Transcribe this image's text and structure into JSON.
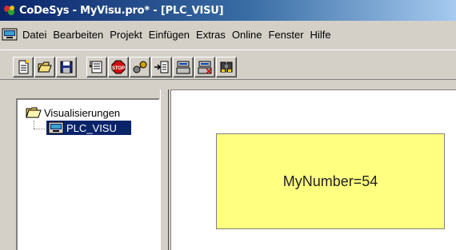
{
  "window": {
    "title": "CoDeSys - MyVisu.pro* - [PLC_VISU]",
    "icon": "codesys-app-icon"
  },
  "menubar": {
    "doc_icon": "visualization-document-icon",
    "items": [
      "Datei",
      "Bearbeiten",
      "Projekt",
      "Einfügen",
      "Extras",
      "Online",
      "Fenster",
      "Hilfe"
    ]
  },
  "toolbar": {
    "buttons": [
      {
        "name": "new-file-icon"
      },
      {
        "name": "open-folder-icon"
      },
      {
        "name": "save-disk-icon"
      },
      {
        "name": "build-list-icon"
      },
      {
        "name": "stop-icon"
      },
      {
        "name": "login-icon"
      },
      {
        "name": "goto-icon"
      },
      {
        "name": "login-plc-icon"
      },
      {
        "name": "logout-plc-icon"
      },
      {
        "name": "find-binoculars-icon"
      }
    ]
  },
  "tree": {
    "root_label": "Visualisierungen",
    "root_icon": "folder-open-icon",
    "child_label": "PLC_VISU",
    "child_icon": "visualization-screen-icon",
    "selection_color": "#0a246a"
  },
  "visu": {
    "box_text": "MyNumber=54",
    "box_color": "#ffff80"
  }
}
